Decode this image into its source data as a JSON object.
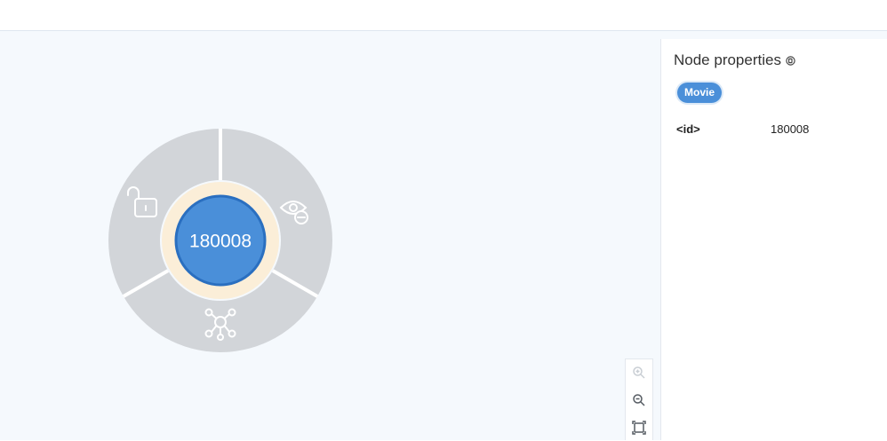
{
  "graph": {
    "node": {
      "label": "180008",
      "color": "#4a8fd9",
      "border_color": "#2a6fc0",
      "halo_color": "#fbeed8"
    },
    "ring_menu": [
      {
        "action": "unlock",
        "icon": "unlock-icon"
      },
      {
        "action": "hide",
        "icon": "eye-hide-icon"
      },
      {
        "action": "expand",
        "icon": "network-expand-icon"
      }
    ]
  },
  "zoom_controls": [
    "zoom-in-icon",
    "zoom-out-icon",
    "fit-view-icon"
  ],
  "panel": {
    "title": "Node properties",
    "label_badge": "Movie",
    "properties": [
      {
        "key": "<id>",
        "value": "180008"
      }
    ]
  }
}
